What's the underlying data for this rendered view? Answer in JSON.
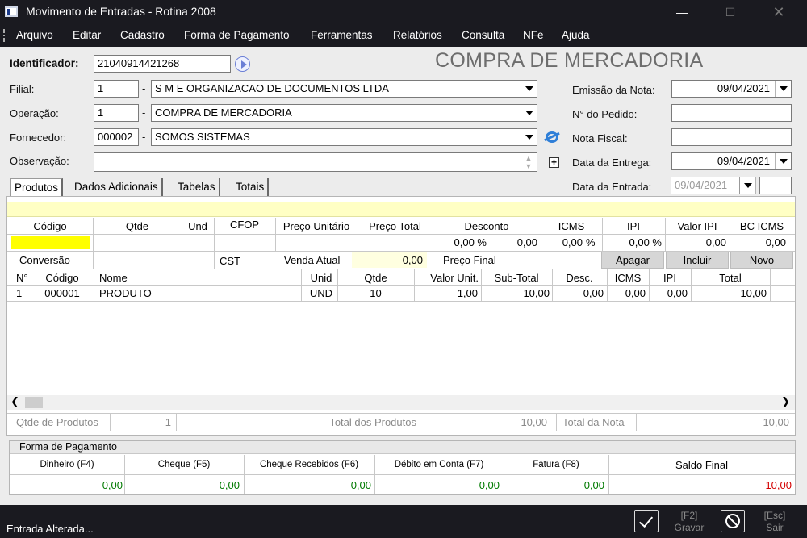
{
  "window": {
    "title": "Movimento de Entradas - Rotina 2008"
  },
  "menu": [
    "Arquivo",
    "Editar",
    "Cadastro",
    "Forma de Pagamento",
    "Ferramentas",
    "Relatórios",
    "Consulta",
    "NFe",
    "Ajuda"
  ],
  "header": {
    "identificador_label": "Identificador:",
    "identificador_value": "21040914421268",
    "page_title": "COMPRA DE MERCADORIA"
  },
  "form": {
    "filial_label": "Filial:",
    "filial_code": "1",
    "filial_name": "S M E ORGANIZACAO DE DOCUMENTOS LTDA",
    "operacao_label": "Operação:",
    "operacao_code": "1",
    "operacao_name": "COMPRA DE MERCADORIA",
    "fornecedor_label": "Fornecedor:",
    "fornecedor_code": "000002",
    "fornecedor_name": "SOMOS SISTEMAS",
    "observacao_label": "Observação:",
    "observacao_value": "",
    "sep": "-",
    "emissao_label": "Emissão da Nota:",
    "emissao_value": "09/04/2021",
    "pedido_label": "N° do Pedido:",
    "pedido_value": "",
    "nota_label": "Nota Fiscal:",
    "nota_value": "",
    "entrega_label": "Data da Entrega:",
    "entrega_value": "09/04/2021",
    "entrada_label": "Data da Entrada:",
    "entrada_value": "09/04/2021"
  },
  "tabs": [
    "Produtos",
    "Dados Adicionais",
    "Tabelas",
    "Totais"
  ],
  "entry": {
    "headers": [
      "Código",
      "Qtde",
      "Und",
      "CFOP",
      "Preço Unitário",
      "Preço Total",
      "Desconto",
      "ICMS",
      "IPI",
      "Valor IPI",
      "BC ICMS"
    ],
    "desconto_pct": "0,00 %",
    "desconto_val": "0,00",
    "icms_pct": "0,00",
    "icms_sym": "%",
    "ipi_pct": "0,00 %",
    "valor_ipi": "0,00",
    "bc_icms": "0,00",
    "conversao_label": "Conversão",
    "cst_label": "CST",
    "venda_atual_label": "Venda Atual",
    "venda_atual_value": "0,00",
    "preco_final_label": "Preço Final",
    "apagar": "Apagar",
    "incluir": "Incluir",
    "novo": "Novo"
  },
  "items": {
    "headers": [
      "N°",
      "Código",
      "Nome",
      "Unid",
      "Qtde",
      "Valor Unit.",
      "Sub-Total",
      "Desc.",
      "ICMS",
      "IPI",
      "Total"
    ],
    "rows": [
      [
        "1",
        "000001",
        "PRODUTO",
        "UND",
        "10",
        "1,00",
        "10,00",
        "0,00",
        "0,00",
        "0,00",
        "10,00"
      ]
    ]
  },
  "totals": {
    "qtde_label": "Qtde de Produtos",
    "qtde_value": "1",
    "total_produtos_label": "Total dos Produtos",
    "total_produtos_value": "10,00",
    "total_nota_label": "Total da Nota",
    "total_nota_value": "10,00"
  },
  "payment": {
    "title": "Forma de Pagamento",
    "headers": [
      "Dinheiro (F4)",
      "Cheque (F5)",
      "Cheque Recebidos (F6)",
      "Débito em Conta (F7)",
      "Fatura (F8)",
      "Saldo Final"
    ],
    "values": [
      "0,00",
      "0,00",
      "0,00",
      "0,00",
      "0,00",
      "10,00"
    ]
  },
  "status": {
    "text": "Entrada Alterada..."
  },
  "actions": {
    "gravar_key": "[F2]",
    "gravar": "Gravar",
    "sair_key": "[Esc]",
    "sair": "Sair"
  },
  "colors": {
    "chrome": "#1a1a20",
    "highlight": "#ffff00",
    "info_bar": "#ffffc4",
    "positive": "#007a00",
    "negative": "#d40000"
  }
}
